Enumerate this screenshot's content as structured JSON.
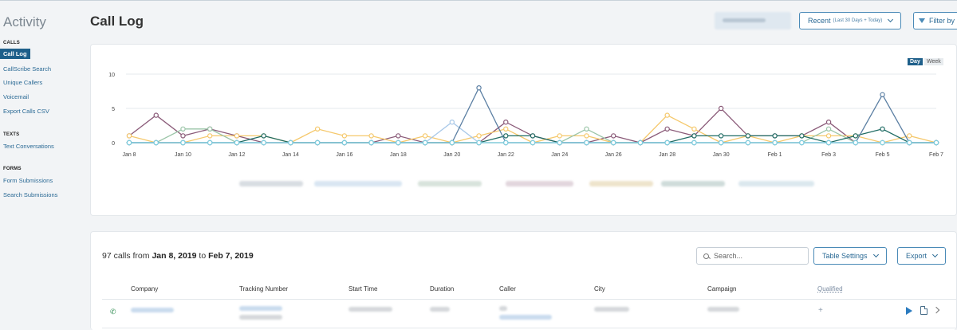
{
  "sidebar": {
    "title": "Activity",
    "sections": [
      {
        "heading": "CALLS",
        "items": [
          {
            "label": "Call Log",
            "active": true
          },
          {
            "label": "CallScribe Search"
          },
          {
            "label": "Unique Callers"
          },
          {
            "label": "Voicemail"
          },
          {
            "label": "Export Calls CSV"
          }
        ]
      },
      {
        "heading": "TEXTS",
        "items": [
          {
            "label": "Text Conversations"
          }
        ]
      },
      {
        "heading": "FORMS",
        "items": [
          {
            "label": "Form Submissions"
          },
          {
            "label": "Search Submissions"
          }
        ]
      }
    ]
  },
  "header": {
    "title": "Call Log",
    "date_filter_label": "Recent",
    "date_filter_sub": "(Last 30 Days + Today)",
    "filter_label": "Filter by"
  },
  "chart_toggle": {
    "day": "Day",
    "week": "Week"
  },
  "chart_data": {
    "type": "line",
    "categories": [
      "Jan 8",
      "Jan 9",
      "Jan 10",
      "Jan 11",
      "Jan 12",
      "Jan 13",
      "Jan 14",
      "Jan 15",
      "Jan 16",
      "Jan 17",
      "Jan 18",
      "Jan 19",
      "Jan 20",
      "Jan 21",
      "Jan 22",
      "Jan 23",
      "Jan 24",
      "Jan 25",
      "Jan 26",
      "Jan 27",
      "Jan 28",
      "Jan 29",
      "Jan 30",
      "Jan 31",
      "Feb 1",
      "Feb 2",
      "Feb 3",
      "Feb 4",
      "Feb 5",
      "Feb 6",
      "Feb 7"
    ],
    "x_tick_labels": [
      "Jan 8",
      "Jan 10",
      "Jan 12",
      "Jan 14",
      "Jan 16",
      "Jan 18",
      "Jan 20",
      "Jan 22",
      "Jan 24",
      "Jan 26",
      "Jan 28",
      "Jan 30",
      "Feb 1",
      "Feb 3",
      "Feb 5",
      "Feb 7"
    ],
    "y_ticks": [
      0,
      5,
      10
    ],
    "ylim": [
      0,
      10
    ],
    "grid": true,
    "series": [
      {
        "color": "#8a5a78",
        "values": [
          1,
          4,
          1,
          2,
          1,
          0,
          0,
          0,
          0,
          0,
          1,
          0,
          0,
          0,
          3,
          1,
          0,
          0,
          1,
          0,
          2,
          1,
          5,
          1,
          1,
          1,
          3,
          0,
          0,
          0,
          0
        ]
      },
      {
        "color": "#f5c86b",
        "values": [
          1,
          0,
          0,
          1,
          1,
          1,
          0,
          2,
          1,
          1,
          0,
          1,
          0,
          1,
          2,
          0,
          1,
          1,
          0,
          0,
          4,
          2,
          0,
          1,
          0,
          1,
          1,
          1,
          0,
          1,
          0
        ]
      },
      {
        "color": "#9bc5a8",
        "values": [
          0,
          0,
          2,
          2,
          0,
          0,
          0,
          0,
          0,
          0,
          0,
          0,
          0,
          0,
          0,
          0,
          0,
          2,
          0,
          0,
          0,
          0,
          0,
          0,
          0,
          0,
          2,
          0,
          0,
          0,
          0
        ]
      },
      {
        "color": "#1e6b63",
        "values": [
          0,
          0,
          0,
          0,
          0,
          1,
          0,
          0,
          0,
          0,
          0,
          0,
          0,
          0,
          1,
          1,
          0,
          0,
          0,
          0,
          0,
          1,
          1,
          1,
          1,
          1,
          0,
          1,
          2,
          0,
          0
        ]
      },
      {
        "color": "#a8c8e8",
        "values": [
          0,
          0,
          0,
          0,
          0,
          0,
          0,
          0,
          0,
          0,
          0,
          0,
          3,
          0,
          0,
          0,
          0,
          0,
          0,
          0,
          0,
          0,
          0,
          0,
          0,
          0,
          0,
          0,
          0,
          0,
          0
        ]
      },
      {
        "color": "#5b7fa3",
        "values": [
          0,
          0,
          0,
          0,
          0,
          0,
          0,
          0,
          0,
          0,
          0,
          0,
          0,
          8,
          0,
          0,
          0,
          0,
          0,
          0,
          0,
          0,
          0,
          0,
          0,
          0,
          0,
          0,
          7,
          0,
          0
        ]
      },
      {
        "color": "#7fcfe0",
        "values": [
          0,
          0,
          0,
          0,
          0,
          0,
          0,
          0,
          0,
          0,
          0,
          0,
          0,
          0,
          0,
          0,
          0,
          0,
          0,
          0,
          0,
          0,
          0,
          0,
          0,
          0,
          0,
          0,
          0,
          0,
          0
        ]
      }
    ]
  },
  "table": {
    "summary_prefix": "97 calls from ",
    "date_from": "Jan 8, 2019",
    "summary_mid": " to ",
    "date_to": "Feb 7, 2019",
    "search_placeholder": "Search...",
    "settings_label": "Table Settings",
    "export_label": "Export",
    "columns": [
      "Company",
      "Tracking Number",
      "Start Time",
      "Duration",
      "Caller",
      "City",
      "Campaign",
      "Qualified"
    ],
    "row_qualified_symbol": "+"
  },
  "colors": {
    "accent": "#1e5f8a",
    "link": "#2b6a95"
  },
  "icons": [
    "search-icon",
    "chevron-down-icon",
    "filter-icon",
    "play-icon",
    "document-icon",
    "chevron-right-icon",
    "incoming-call-icon"
  ]
}
